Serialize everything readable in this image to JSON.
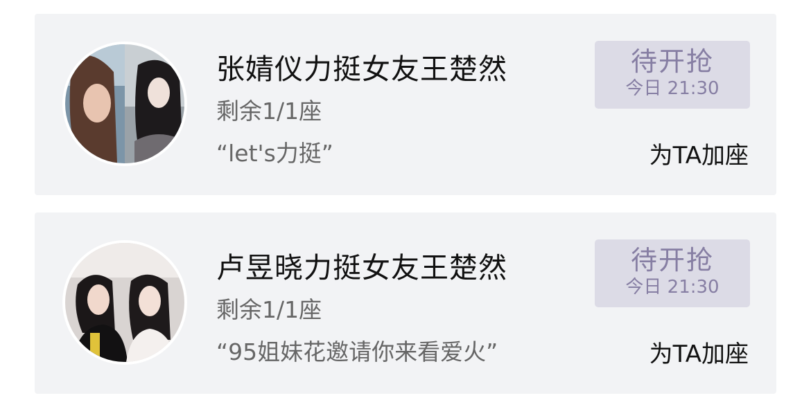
{
  "cards": [
    {
      "title": "张婧仪力挺女友王楚然",
      "seats": "剩余1/1座",
      "quote": "“let's力挺”",
      "status_label": "待开抢",
      "status_time": "今日 21:30",
      "action_label": "为TA加座"
    },
    {
      "title": "卢昱晓力挺女友王楚然",
      "seats": "剩余1/1座",
      "quote": "“95姐妹花邀请你来看爱火”",
      "status_label": "待开抢",
      "status_time": "今日 21:30",
      "action_label": "为TA加座"
    }
  ],
  "colors": {
    "card_bg": "#f2f3f5",
    "status_bg": "#dcdbe6",
    "status_text": "#867ea3",
    "secondary_text": "#666666",
    "primary_text": "#111111"
  }
}
